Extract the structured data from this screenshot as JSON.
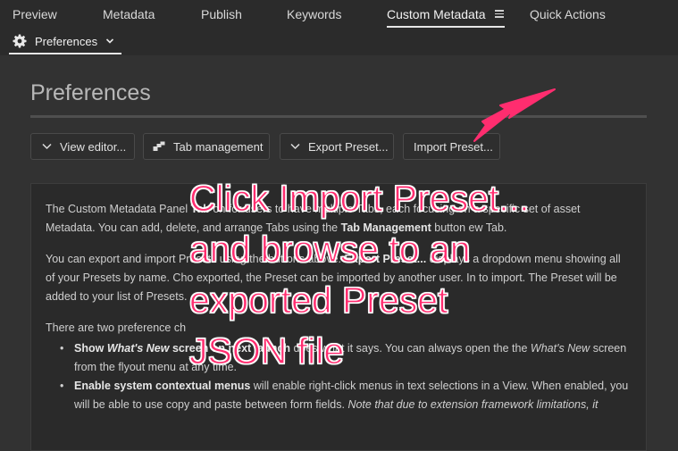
{
  "tabs": [
    {
      "label": "Preview"
    },
    {
      "label": "Metadata"
    },
    {
      "label": "Publish"
    },
    {
      "label": "Keywords"
    },
    {
      "label": "Custom Metadata",
      "active": true
    },
    {
      "label": "Quick Actions"
    }
  ],
  "subtab": {
    "label": "Preferences"
  },
  "page": {
    "title": "Preferences"
  },
  "buttons": {
    "view_editor": "View editor...",
    "tab_management": "Tab management",
    "export_preset": "Export Preset...",
    "import_preset": "Import Preset..."
  },
  "description": {
    "p1_a": "The Custom Metadata Panel",
    "p1_b": "Tab",
    "p1_c": "on for users",
    "p1_d": "to have multiple Tabs, each focusing on a specific set of asset Metadata. You can add, delete, and arrange Tabs using",
    "p1_e": "the",
    "p1_f": "Tab Management",
    "p1_g": "button",
    "p1_h": "ew Tab.",
    "p2_a": "You can export and import Presets using the buttons above.",
    "p2_b": "Export Preset...",
    "p2_c": "displays a dropdown menu showing all",
    "p2_d": "of your Presets by name. Cho",
    "p2_e": "exported, the Preset can be",
    "p2_f": "imported by another user. In",
    "p2_g": "to import. The Preset will be",
    "p2_h": "added to your list of Presets.",
    "p3": "There are two preference ch",
    "bullet1_a": "Show",
    "bullet1_b": "What's New",
    "bullet1_c": "screen on next launch",
    "bullet1_d": "does what it says. You can always open the the",
    "bullet1_e": "What's New",
    "bullet1_f": "screen",
    "bullet1_g": "from the flyout menu at any time.",
    "bullet2_a": "Enable system contextual menus",
    "bullet2_b": "will enable right-click menus in text selections in a View. When enabled,",
    "bullet2_c": "you will be able to use copy and paste between form fields.",
    "bullet2_d": "Note that due to extension framework limitations, it"
  },
  "annotation": {
    "text": "Click Import Preset...\nand browse to an\nexported Preset\nJSON file",
    "color": "#ff2d6f"
  },
  "icons": {
    "subtab": "gear-icon",
    "view_editor": "chevron-down-icon",
    "tab_management": "tab-management-icon",
    "export_preset": "chevron-down-icon",
    "arrow": "annotation-arrow-icon"
  }
}
